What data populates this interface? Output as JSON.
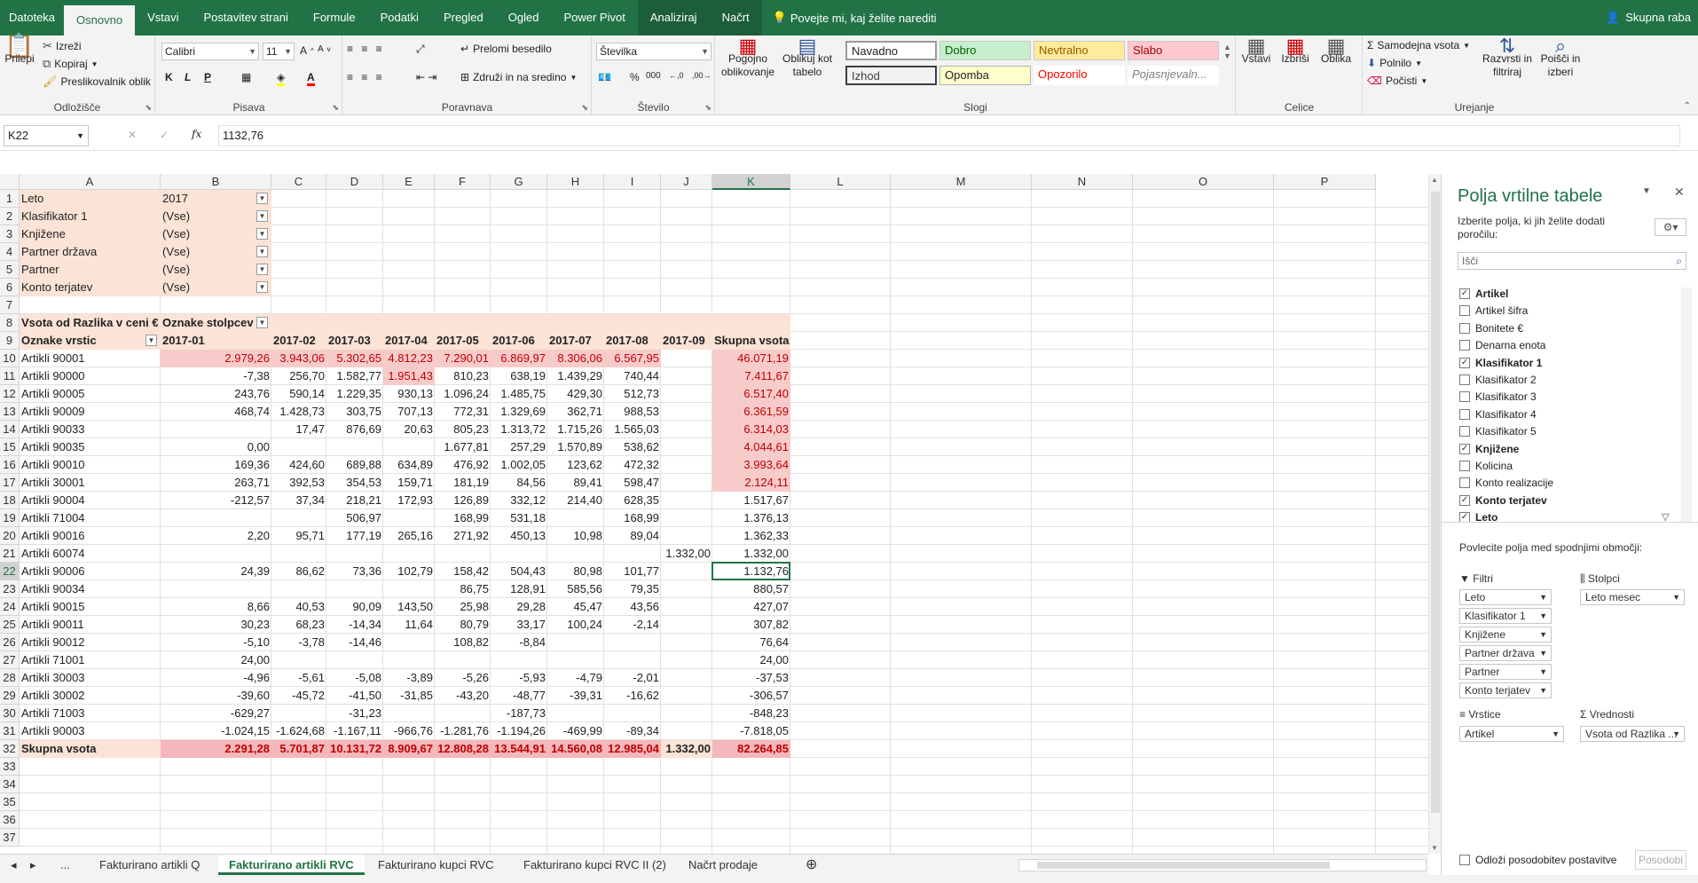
{
  "ribbon_tabs": [
    "Datoteka",
    "Osnovno",
    "Vstavi",
    "Postavitev strani",
    "Formule",
    "Podatki",
    "Pregled",
    "Ogled",
    "Power Pivot",
    "Analiziraj",
    "Načrt"
  ],
  "tell_me": "Povejte mi, kaj želite narediti",
  "share": "Skupna raba",
  "clipboard": {
    "paste": "Prilepi",
    "cut": "Izreži",
    "copy": "Kopiraj",
    "painter": "Preslikovalnik oblik",
    "label": "Odložišče"
  },
  "font": {
    "name": "Calibri",
    "size": "11",
    "label": "Pisava",
    "bold": "K",
    "italic": "L",
    "underline": "P"
  },
  "alignment": {
    "wrap": "Prelomi besedilo",
    "merge": "Združi in na sredino",
    "label": "Poravnava"
  },
  "number": {
    "format": "Številka",
    "label": "Število"
  },
  "styles": {
    "cond": "Pogojno oblikovanje",
    "table": "Oblikuj kot tabelo",
    "label": "Slogi",
    "cells": [
      "Navadno",
      "Dobro",
      "Nevtralno",
      "Slabo",
      "Izhod",
      "Opomba",
      "Opozorilo",
      "Pojasnjevaln..."
    ]
  },
  "cells_grp": {
    "insert": "Vstavi",
    "delete": "Izbriši",
    "format": "Oblika",
    "label": "Celice"
  },
  "editing": {
    "autosum": "Samodejna vsota",
    "fill": "Polnilo",
    "clear": "Počisti",
    "sort": "Razvrsti in filtriraj",
    "find": "Poišči in izberi",
    "label": "Urejanje"
  },
  "namebox": "K22",
  "formula": "1132,76",
  "columns": [
    "A",
    "B",
    "C",
    "D",
    "E",
    "F",
    "G",
    "H",
    "I",
    "J",
    "K",
    "L",
    "M",
    "N",
    "O",
    "P"
  ],
  "filters": [
    {
      "label": "Leto",
      "value": "2017"
    },
    {
      "label": "Klasifikator 1",
      "value": "(Vse)"
    },
    {
      "label": "Knjižene",
      "value": "(Vse)"
    },
    {
      "label": "Partner država",
      "value": "(Vse)"
    },
    {
      "label": "Partner",
      "value": "(Vse)"
    },
    {
      "label": "Konto terjatev",
      "value": "(Vse)"
    }
  ],
  "pivot": {
    "values_label": "Vsota od Razlika v ceni €",
    "col_labels": "Oznake stolpcev",
    "row_labels": "Oznake vrstic",
    "months": [
      "2017-01",
      "2017-02",
      "2017-03",
      "2017-04",
      "2017-05",
      "2017-06",
      "2017-07",
      "2017-08",
      "2017-09",
      "Skupna vsota"
    ],
    "rows": [
      [
        "Artikli 90001",
        "2.979,26",
        "3.943,06",
        "5.302,65",
        "4.812,23",
        "7.290,01",
        "6.869,97",
        "8.306,06",
        "6.567,95",
        "",
        "46.071,19"
      ],
      [
        "Artikli 90000",
        "-7,38",
        "256,70",
        "1.582,77",
        "1.951,43",
        "810,23",
        "638,19",
        "1.439,29",
        "740,44",
        "",
        "7.411,67"
      ],
      [
        "Artikli 90005",
        "243,76",
        "590,14",
        "1.229,35",
        "930,13",
        "1.096,24",
        "1.485,75",
        "429,30",
        "512,73",
        "",
        "6.517,40"
      ],
      [
        "Artikli 90009",
        "468,74",
        "1.428,73",
        "303,75",
        "707,13",
        "772,31",
        "1.329,69",
        "362,71",
        "988,53",
        "",
        "6.361,59"
      ],
      [
        "Artikli 90033",
        "",
        "17,47",
        "876,69",
        "20,63",
        "805,23",
        "1.313,72",
        "1.715,26",
        "1.565,03",
        "",
        "6.314,03"
      ],
      [
        "Artikli 90035",
        "0,00",
        "",
        "",
        "",
        "1.677,81",
        "257,29",
        "1.570,89",
        "538,62",
        "",
        "4.044,61"
      ],
      [
        "Artikli 90010",
        "169,36",
        "424,60",
        "689,88",
        "634,89",
        "476,92",
        "1.002,05",
        "123,62",
        "472,32",
        "",
        "3.993,64"
      ],
      [
        "Artikli 30001",
        "263,71",
        "392,53",
        "354,53",
        "159,71",
        "181,19",
        "84,56",
        "89,41",
        "598,47",
        "",
        "2.124,11"
      ],
      [
        "Artikli 90004",
        "-212,57",
        "37,34",
        "218,21",
        "172,93",
        "126,89",
        "332,12",
        "214,40",
        "628,35",
        "",
        "1.517,67"
      ],
      [
        "Artikli 71004",
        "",
        "",
        "506,97",
        "",
        "168,99",
        "531,18",
        "",
        "168,99",
        "",
        "1.376,13"
      ],
      [
        "Artikli 90016",
        "2,20",
        "95,71",
        "177,19",
        "265,16",
        "271,92",
        "450,13",
        "10,98",
        "89,04",
        "",
        "1.362,33"
      ],
      [
        "Artikli 60074",
        "",
        "",
        "",
        "",
        "",
        "",
        "",
        "",
        "1.332,00",
        "1.332,00"
      ],
      [
        "Artikli 90006",
        "24,39",
        "86,62",
        "73,36",
        "102,79",
        "158,42",
        "504,43",
        "80,98",
        "101,77",
        "",
        "1.132,76"
      ],
      [
        "Artikli 90034",
        "",
        "",
        "",
        "",
        "86,75",
        "128,91",
        "585,56",
        "79,35",
        "",
        "880,57"
      ],
      [
        "Artikli 90015",
        "8,66",
        "40,53",
        "90,09",
        "143,50",
        "25,98",
        "29,28",
        "45,47",
        "43,56",
        "",
        "427,07"
      ],
      [
        "Artikli 90011",
        "30,23",
        "68,23",
        "-14,34",
        "11,64",
        "80,79",
        "33,17",
        "100,24",
        "-2,14",
        "",
        "307,82"
      ],
      [
        "Artikli 90012",
        "-5,10",
        "-3,78",
        "-14,46",
        "",
        "108,82",
        "-8,84",
        "",
        "",
        "",
        "76,64"
      ],
      [
        "Artikli 71001",
        "24,00",
        "",
        "",
        "",
        "",
        "",
        "",
        "",
        "",
        "24,00"
      ],
      [
        "Artikli 30003",
        "-4,96",
        "-5,61",
        "-5,08",
        "-3,89",
        "-5,26",
        "-5,93",
        "-4,79",
        "-2,01",
        "",
        "-37,53"
      ],
      [
        "Artikli 30002",
        "-39,60",
        "-45,72",
        "-41,50",
        "-31,85",
        "-43,20",
        "-48,77",
        "-39,31",
        "-16,62",
        "",
        "-306,57"
      ],
      [
        "Artikli 71003",
        "-629,27",
        "",
        "-31,23",
        "",
        "",
        "-187,73",
        "",
        "",
        "",
        "-848,23"
      ],
      [
        "Artikli 90003",
        "-1.024,15",
        "-1.624,68",
        "-1.167,11",
        "-966,76",
        "-1.281,76",
        "-1.194,26",
        "-469,99",
        "-89,34",
        "",
        "-7.818,05"
      ]
    ],
    "total": [
      "Skupna vsota",
      "2.291,28",
      "5.701,87",
      "10.131,72",
      "8.909,67",
      "12.808,28",
      "13.544,91",
      "14.560,08",
      "12.985,04",
      "1.332,00",
      "82.264,85"
    ]
  },
  "sheet_tabs": [
    "Fakturirano artikli Q",
    "Fakturirano artikli RVC",
    "Fakturirano kupci RVC",
    "Fakturirano kupci RVC II (2)",
    "Načrt prodaje"
  ],
  "pane": {
    "title": "Polja vrtilne tabele",
    "subtitle": "Izberite polja, ki jih želite dodati poročilu:",
    "search": "Išči",
    "fields": [
      {
        "name": "Artikel",
        "checked": true
      },
      {
        "name": "Artikel šifra",
        "checked": false
      },
      {
        "name": "Bonitete €",
        "checked": false
      },
      {
        "name": "Denarna enota",
        "checked": false
      },
      {
        "name": "Klasifikator 1",
        "checked": true
      },
      {
        "name": "Klasifikator 2",
        "checked": false
      },
      {
        "name": "Klasifikator 3",
        "checked": false
      },
      {
        "name": "Klasifikator 4",
        "checked": false
      },
      {
        "name": "Klasifikator 5",
        "checked": false
      },
      {
        "name": "Knjižene",
        "checked": true
      },
      {
        "name": "Kolicina",
        "checked": false
      },
      {
        "name": "Konto realizacije",
        "checked": false
      },
      {
        "name": "Konto terjatev",
        "checked": true
      },
      {
        "name": "Leto",
        "checked": true
      }
    ],
    "drag_label": "Povlecite polja med spodnjimi območji:",
    "filters_title": "Filtri",
    "filters": [
      "Leto",
      "Klasifikator 1",
      "Knjižene",
      "Partner država",
      "Partner",
      "Konto terjatev"
    ],
    "columns_title": "Stolpci",
    "columns": [
      "Leto mesec"
    ],
    "rows_title": "Vrstice",
    "rows": [
      "Artikel"
    ],
    "values_title": "Vrednosti",
    "values": [
      "Vsota od Razlika ..."
    ],
    "defer": "Odloži posodobitev postavitve",
    "update": "Posodobi"
  }
}
